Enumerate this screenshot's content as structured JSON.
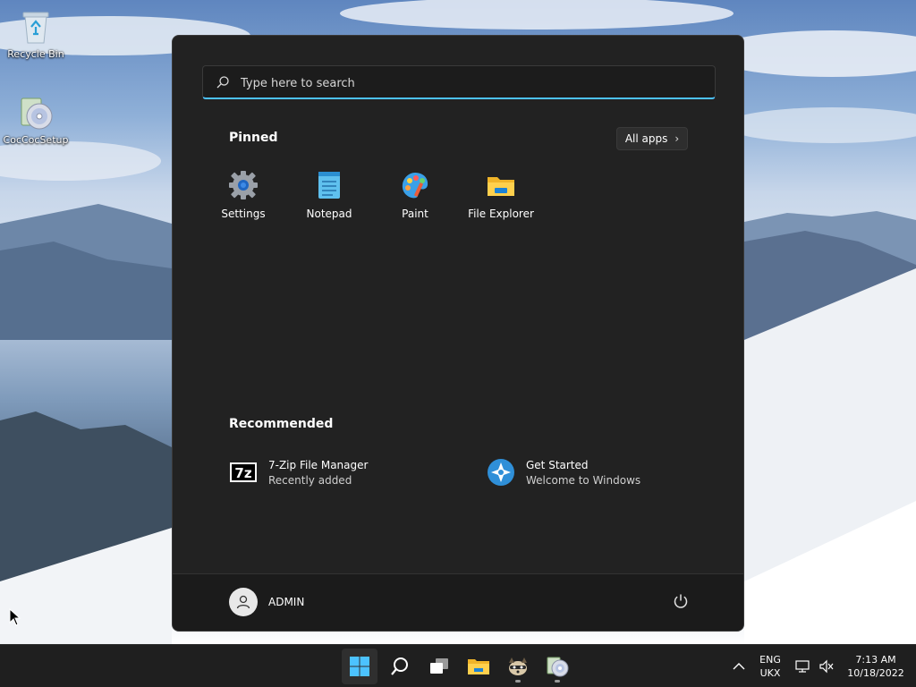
{
  "desktop": {
    "icons": [
      {
        "label": "Recycle Bin",
        "icon": "recycle-bin-icon"
      },
      {
        "label": "CocCocSetup",
        "icon": "disc-installer-icon"
      }
    ]
  },
  "start_menu": {
    "search": {
      "placeholder": "Type here to search",
      "value": ""
    },
    "pinned": {
      "title": "Pinned",
      "all_apps_label": "All apps",
      "apps": [
        {
          "label": "Settings",
          "icon": "gear-icon"
        },
        {
          "label": "Notepad",
          "icon": "notepad-icon"
        },
        {
          "label": "Paint",
          "icon": "paint-palette-icon"
        },
        {
          "label": "File Explorer",
          "icon": "folder-icon"
        }
      ]
    },
    "recommended": {
      "title": "Recommended",
      "items": [
        {
          "title": "7-Zip File Manager",
          "subtitle": "Recently added",
          "icon": "7zip-icon",
          "icon_text": "7z"
        },
        {
          "title": "Get Started",
          "subtitle": "Welcome to Windows",
          "icon": "get-started-icon"
        }
      ]
    },
    "user": {
      "name": "ADMIN"
    }
  },
  "taskbar": {
    "apps": [
      "windows-start-icon",
      "search-icon",
      "task-view-icon",
      "file-explorer-icon",
      "raccoon-app-icon",
      "installer-icon"
    ],
    "tray": {
      "language_line1": "ENG",
      "language_line2": "UKX",
      "time": "7:13 AM",
      "date": "10/18/2022"
    }
  },
  "colors": {
    "accent": "#4cc2ff",
    "start_bg": "#222222",
    "taskbar_bg": "#1f1f1f"
  }
}
